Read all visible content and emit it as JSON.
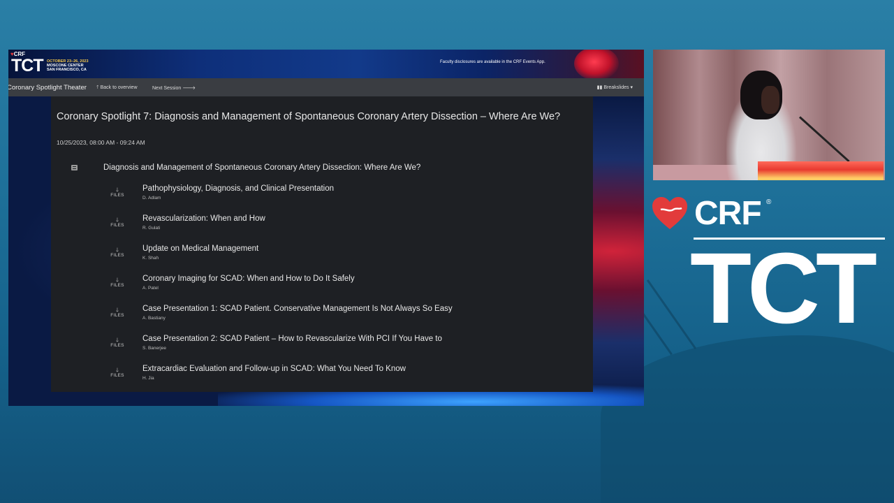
{
  "banner": {
    "crf_small": "CRF",
    "tct_small": "TCT",
    "event_dates": "OCTOBER 23–26, 2023",
    "event_venue": "MOSCONE CENTER",
    "event_city": "SAN FRANCISCO, CA",
    "disclosure": "Faculty disclosures are available in the CRF Events App."
  },
  "nav": {
    "brand": "Coronary Spotlight Theater",
    "back": "Back to overview",
    "next": "Next Session",
    "breakslides": "Breakslides"
  },
  "session": {
    "title": "Coronary Spotlight 7: Diagnosis and Management of Spontaneous Coronary Artery Dissection – Where Are We?",
    "time": "10/25/2023, 08:00 AM - 09:24 AM",
    "section_title": "Diagnosis and Management of Spontaneous Coronary Artery Dissection: Where Are We?",
    "files_label": "FILES",
    "talks": [
      {
        "title": "Pathophysiology, Diagnosis, and Clinical Presentation",
        "speaker": "D. Adlam"
      },
      {
        "title": "Revascularization: When and How",
        "speaker": "R. Gulati"
      },
      {
        "title": "Update on Medical Management",
        "speaker": "K. Shah"
      },
      {
        "title": "Coronary Imaging for SCAD: When and How to Do It Safely",
        "speaker": "A. Patel"
      },
      {
        "title": "Case Presentation 1: SCAD Patient. Conservative Management Is Not Always So Easy",
        "speaker": "A. Bastiany"
      },
      {
        "title": "Case Presentation 2: SCAD Patient – How to Revascularize With PCI If You Have to",
        "speaker": "S. Banerjee"
      },
      {
        "title": "Extracardiac Evaluation and Follow-up in SCAD: What You Need To Know",
        "speaker": "H. Jia"
      }
    ]
  },
  "brand": {
    "crf": "CRF",
    "reg": "®",
    "tct": "TCT"
  },
  "colors": {
    "page_bg": "#1d6f98",
    "panel_bg": "#1e2024",
    "navbar_bg": "#3a3d42",
    "brand_red": "#e23b3b"
  },
  "icons": {
    "back": "arrow-up-icon",
    "next": "arrow-right-icon",
    "breakslides": "columns-icon",
    "files": "arrow-down-icon",
    "section": "list-icon"
  }
}
